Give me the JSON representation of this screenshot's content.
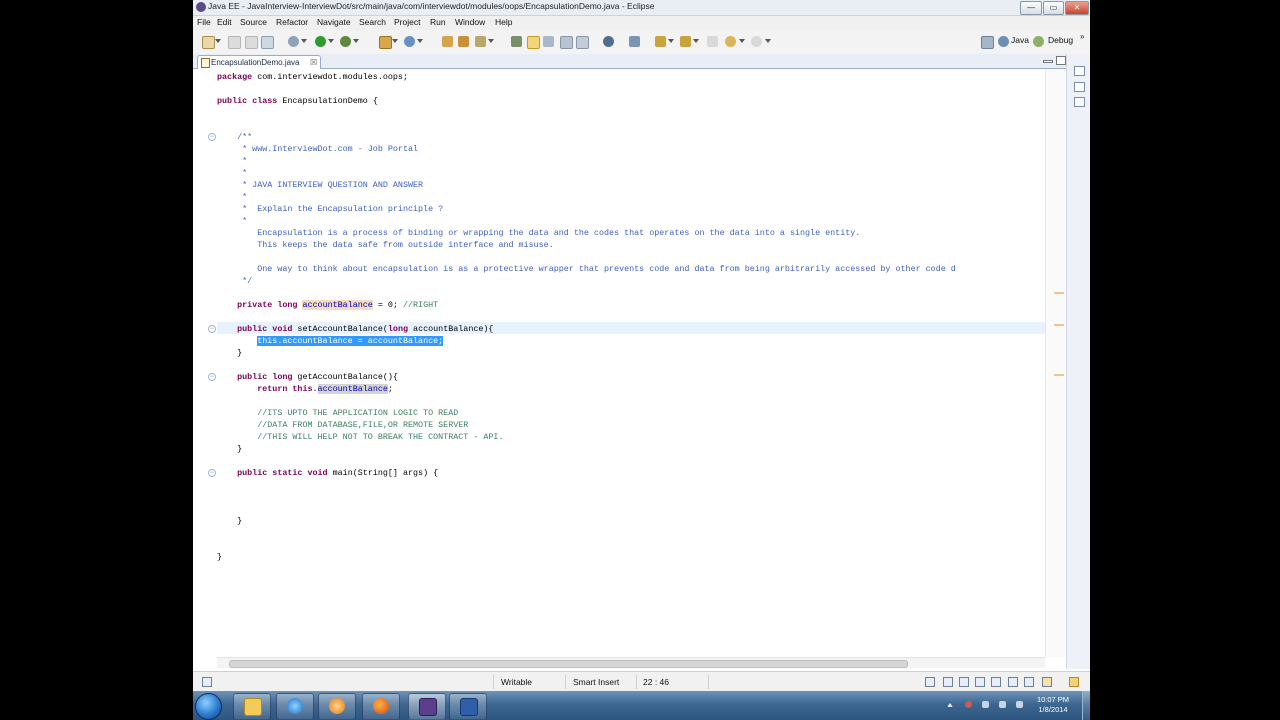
{
  "window": {
    "title": "Java EE - JavaInterview-InterviewDot/src/main/java/com/interviewdot/modules/oops/EncapsulationDemo.java - Eclipse",
    "controls": [
      "—",
      "▭",
      "✕"
    ]
  },
  "menu": [
    "File",
    "Edit",
    "Source",
    "Refactor",
    "Navigate",
    "Search",
    "Project",
    "Run",
    "Window",
    "Help"
  ],
  "toolbar": {
    "perspectives": [
      "Java",
      "Debug"
    ]
  },
  "editor": {
    "tab_label": "EncapsulationDemo.java",
    "tab_close": "☒",
    "code_lines": [
      [
        {
          "t": "package",
          "c": "kw"
        },
        {
          "t": " com.interviewdot.modules.oops;"
        }
      ],
      [],
      [
        {
          "t": "public",
          "c": "kw"
        },
        {
          "t": " "
        },
        {
          "t": "class",
          "c": "kw"
        },
        {
          "t": " EncapsulationDemo {"
        }
      ],
      [],
      [],
      [
        {
          "t": "    /**",
          "c": "cm"
        }
      ],
      [
        {
          "t": "     * www.InterviewDot.com - Job Portal",
          "c": "cm"
        }
      ],
      [
        {
          "t": "     *",
          "c": "cm"
        }
      ],
      [
        {
          "t": "     *",
          "c": "cm"
        }
      ],
      [
        {
          "t": "     * JAVA INTERVIEW QUESTION AND ANSWER",
          "c": "cm"
        }
      ],
      [
        {
          "t": "     *",
          "c": "cm"
        }
      ],
      [
        {
          "t": "     *  Explain the Encapsulation principle ?",
          "c": "cm"
        }
      ],
      [
        {
          "t": "     *",
          "c": "cm"
        }
      ],
      [
        {
          "t": "        Encapsulation is a process of binding or wrapping the data and the codes that operates on the data into a single entity.",
          "c": "cm"
        }
      ],
      [
        {
          "t": "        This keeps the data safe from outside interface and misuse.",
          "c": "cm"
        }
      ],
      [],
      [
        {
          "t": "        One way to think about encapsulation is as a protective wrapper that prevents code and data from being arbitrarily accessed by other code d",
          "c": "cm"
        }
      ],
      [
        {
          "t": "     */",
          "c": "cm"
        }
      ],
      [],
      [
        {
          "t": "    "
        },
        {
          "t": "private",
          "c": "kw"
        },
        {
          "t": " "
        },
        {
          "t": "long",
          "c": "kw"
        },
        {
          "t": " "
        },
        {
          "t": "accountBalance",
          "c": "fd occ"
        },
        {
          "t": " = 0; "
        },
        {
          "t": "//RIGHT",
          "c": "lc"
        }
      ],
      [],
      [
        {
          "t": "    "
        },
        {
          "t": "public",
          "c": "kw"
        },
        {
          "t": " "
        },
        {
          "t": "void",
          "c": "kw"
        },
        {
          "t": " setAccountBalance("
        },
        {
          "t": "long",
          "c": "kw"
        },
        {
          "t": " accountBalance){"
        }
      ],
      [
        {
          "t": "        "
        },
        {
          "t": "this.accountBalance = accountBalance;",
          "c": "sel"
        }
      ],
      [
        {
          "t": "    }"
        }
      ],
      [],
      [
        {
          "t": "    "
        },
        {
          "t": "public",
          "c": "kw"
        },
        {
          "t": " "
        },
        {
          "t": "long",
          "c": "kw"
        },
        {
          "t": " getAccountBalance(){"
        }
      ],
      [
        {
          "t": "        "
        },
        {
          "t": "return",
          "c": "kw"
        },
        {
          "t": " "
        },
        {
          "t": "this",
          "c": "kw"
        },
        {
          "t": "."
        },
        {
          "t": "accountBalance",
          "c": "fd occ2"
        },
        {
          "t": ";"
        }
      ],
      [],
      [
        {
          "t": "        "
        },
        {
          "t": "//ITS UPTO THE APPLICATION LOGIC TO READ",
          "c": "lc"
        }
      ],
      [
        {
          "t": "        "
        },
        {
          "t": "//DATA FROM DATABASE,FILE,OR REMOTE SERVER",
          "c": "lc"
        }
      ],
      [
        {
          "t": "        "
        },
        {
          "t": "//THIS WILL HELP NOT TO BREAK THE CONTRACT - API.",
          "c": "lc"
        }
      ],
      [
        {
          "t": "    }"
        }
      ],
      [],
      [
        {
          "t": "    "
        },
        {
          "t": "public",
          "c": "kw"
        },
        {
          "t": " "
        },
        {
          "t": "static",
          "c": "kw"
        },
        {
          "t": " "
        },
        {
          "t": "void",
          "c": "kw"
        },
        {
          "t": " main(String[] args) {"
        }
      ],
      [],
      [],
      [],
      [
        {
          "t": "    }"
        }
      ],
      [],
      [],
      [
        {
          "t": "}"
        }
      ]
    ]
  },
  "status": {
    "mode": "Writable",
    "insert": "Smart Insert",
    "position": "22 : 46"
  },
  "taskbar": {
    "time": "10:07 PM",
    "date": "1/8/2014"
  }
}
